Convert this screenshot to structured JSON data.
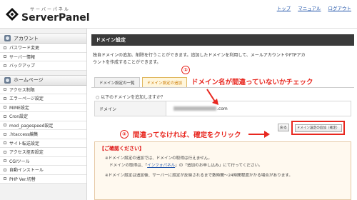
{
  "header": {
    "logo_sub": "サーバーパネル",
    "logo_main": "ServerPanel",
    "nav": [
      "トップ",
      "マニュアル",
      "ログアウト"
    ]
  },
  "sidebar": {
    "account_title": "アカウント",
    "account_items": [
      "パスワード変更",
      "サーバー情報",
      "バックアップ"
    ],
    "homepage_title": "ホームページ",
    "homepage_items": [
      "アクセス制限",
      "エラーページ設定",
      "MIME設定",
      "Cron設定",
      "mod_pagespeed設定",
      ".htaccess編集",
      "サイト転送設定",
      "アクセス拒否設定",
      "CGIツール",
      "自動インストール",
      "PHP Ver.切替"
    ]
  },
  "main": {
    "title": "ドメイン設定",
    "intro": "独自ドメインの追加、削除を行うことができます。追加したドメインを利用して、メールアカウントやFTPアカウントを作成することができます。",
    "tabs": [
      "ドメイン設定の一覧",
      "ドメイン設定の追加"
    ],
    "question": "○ 以下のドメインを追加しますか？",
    "domain_label": "ドメイン",
    "domain_suffix": ".com",
    "back_button": "戻る",
    "confirm_button": "ドメイン設定の追加（確定）",
    "notice": {
      "title": "【ご確認ください】",
      "line1": "※ドメイン設定の追加では、ドメインの取得は行えません。",
      "line2_pre": "ドメインの取得は、「",
      "line2_link": "インフォパネル",
      "line2_post": "」の「追加のお申し込み」にて行ってください。",
      "line3": "※ドメイン設定は追加後、サーバーに設定が反映されるまで数時間〜24時間程度かかる場合があります。"
    }
  },
  "annotations": {
    "num1": "①",
    "text1": "ドメイン名が間違っていないかチェック",
    "num2": "②",
    "text2": "間違ってなければ、確定をクリック"
  }
}
